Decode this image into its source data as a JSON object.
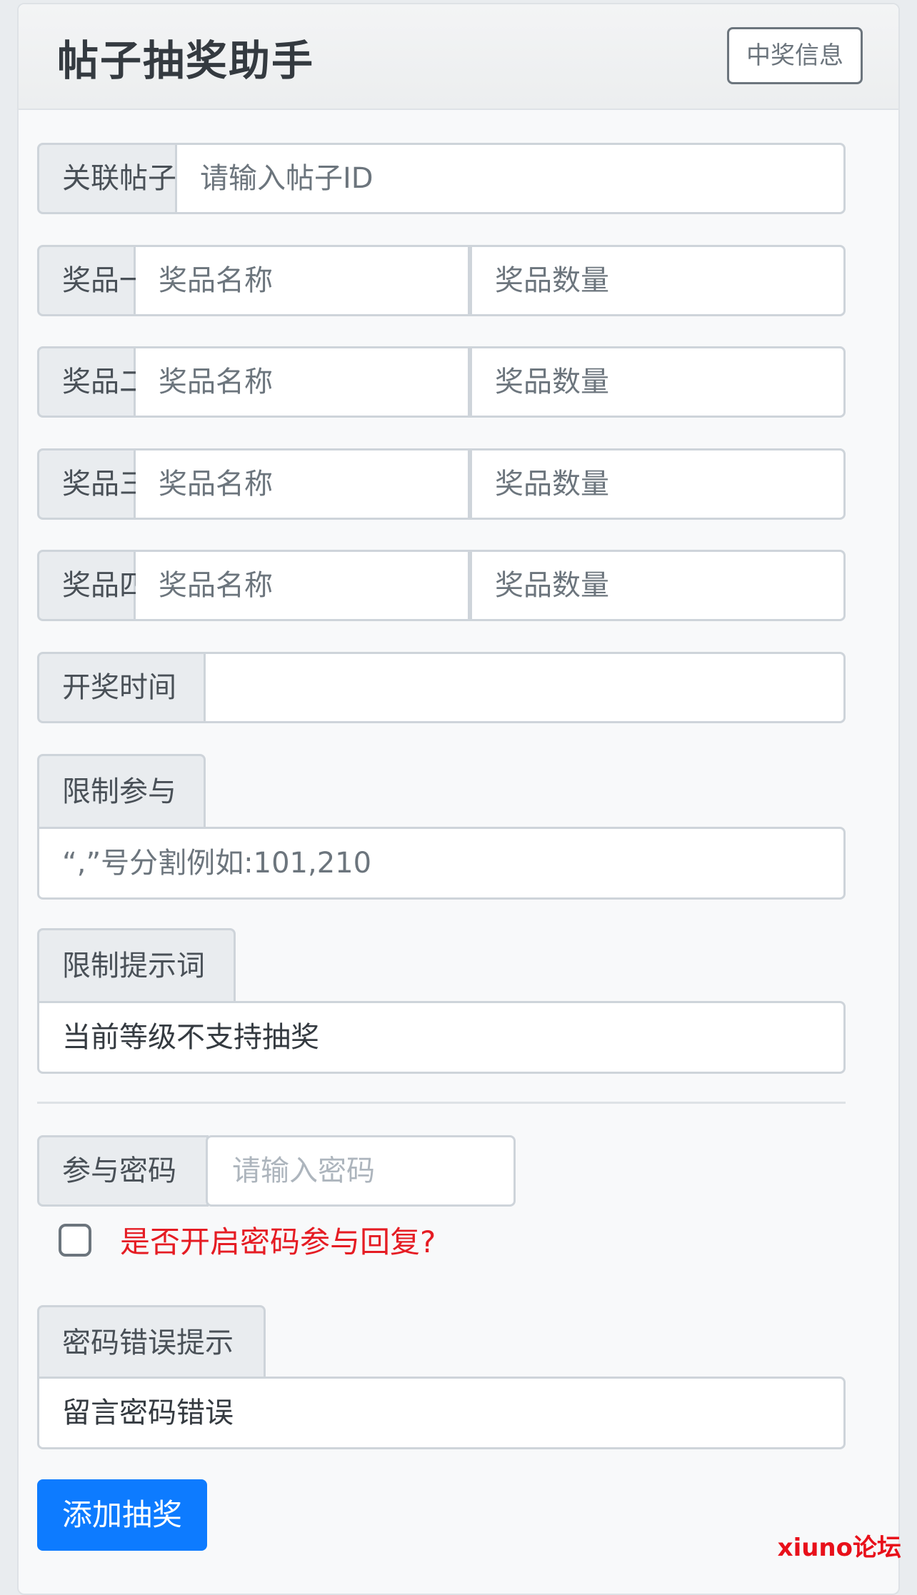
{
  "header": {
    "title": "帖子抽奖助手",
    "winners_button": "中奖信息"
  },
  "form": {
    "post_id": {
      "label": "关联帖子ID",
      "placeholder": "请输入帖子ID"
    },
    "prizes": [
      {
        "label": "奖品一",
        "name_placeholder": "奖品名称",
        "qty_placeholder": "奖品数量"
      },
      {
        "label": "奖品二",
        "name_placeholder": "奖品名称",
        "qty_placeholder": "奖品数量"
      },
      {
        "label": "奖品三",
        "name_placeholder": "奖品名称",
        "qty_placeholder": "奖品数量"
      },
      {
        "label": "奖品四",
        "name_placeholder": "奖品名称",
        "qty_placeholder": "奖品数量"
      }
    ],
    "draw_time": {
      "label": "开奖时间",
      "value": ""
    },
    "restrict": {
      "label": "限制参与",
      "placeholder": "“,”号分割例如:101,210"
    },
    "restrict_hint": {
      "label": "限制提示词",
      "value": "当前等级不支持抽奖"
    },
    "password": {
      "label": "参与密码",
      "placeholder": "请输入密码"
    },
    "password_reply": {
      "label": "是否开启密码参与回复?",
      "checked": false
    },
    "password_error": {
      "label": "密码错误提示",
      "value": "留言密码错误"
    },
    "submit": "添加抽奖"
  },
  "watermark": "xiuno论坛",
  "colors": {
    "primary": "#0d7bff",
    "danger": "#e51c23",
    "watermark": "#e8101a"
  }
}
